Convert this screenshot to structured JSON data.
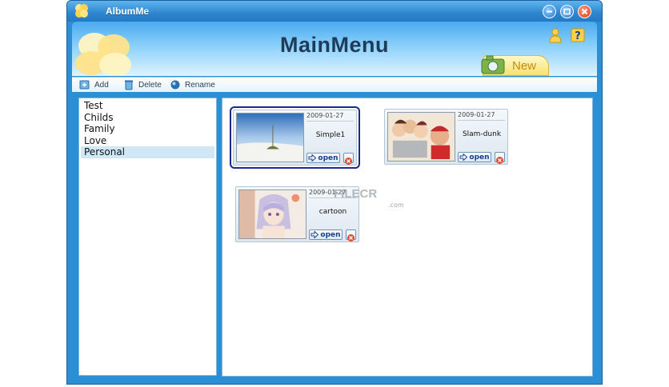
{
  "window": {
    "title": "AlbumMe"
  },
  "header": {
    "title": "MainMenu",
    "new_label": "New"
  },
  "toolbar": {
    "add_label": "Add",
    "delete_label": "Delete",
    "rename_label": "Rename"
  },
  "albums": [
    "Test",
    "Childs",
    "Family",
    "Love",
    "Personal"
  ],
  "selected_album": "Personal",
  "cards": [
    {
      "date": "2009-01-27",
      "name": "Simple1",
      "open_label": "open"
    },
    {
      "date": "2009-01-27",
      "name": "Slam-dunk",
      "open_label": "open"
    },
    {
      "date": "2009-01-27",
      "name": "cartoon",
      "open_label": "open"
    }
  ],
  "watermark": {
    "main": "FILECR",
    "sub": ".com"
  },
  "colors": {
    "window_frame": "#2b8fd6",
    "title_text": "#1e3c5a",
    "selection": "#cfe7f7",
    "new_tab": "#f5e272"
  },
  "icons": [
    "clover-logo-icon",
    "minimize-icon",
    "maximize-icon",
    "close-icon",
    "user-icon",
    "help-icon",
    "camera-icon",
    "add-icon",
    "delete-icon",
    "rename-icon",
    "open-arrow-icon",
    "delete-x-icon"
  ]
}
